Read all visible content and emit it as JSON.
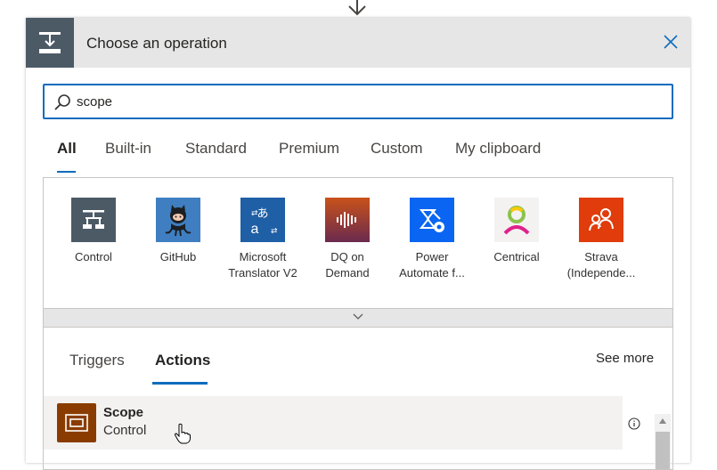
{
  "dialog": {
    "title": "Choose an operation",
    "header_icon": "operation-icon",
    "close_icon": "close-icon"
  },
  "search": {
    "value": "scope",
    "icon": "search-icon"
  },
  "tabs": [
    {
      "label": "All",
      "active": true
    },
    {
      "label": "Built-in"
    },
    {
      "label": "Standard"
    },
    {
      "label": "Premium"
    },
    {
      "label": "Custom"
    },
    {
      "label": "My clipboard"
    }
  ],
  "connectors": [
    {
      "label_line1": "Control",
      "label_line2": "",
      "icon": "control-icon",
      "color": "#4c5a66"
    },
    {
      "label_line1": "GitHub",
      "label_line2": "",
      "icon": "github-octocat-icon",
      "color": "#3f7fc1"
    },
    {
      "label_line1": "Microsoft",
      "label_line2": "Translator V2",
      "icon": "translator-icon",
      "color": "#1f5fa6"
    },
    {
      "label_line1": "DQ on",
      "label_line2": "Demand",
      "icon": "soundwave-icon",
      "color": "#c14f1c"
    },
    {
      "label_line1": "Power",
      "label_line2": "Automate f...",
      "icon": "power-automate-icon",
      "color": "#0a66f2"
    },
    {
      "label_line1": "Centrical",
      "label_line2": "",
      "icon": "centrical-icon",
      "color": "#f3f2f1"
    },
    {
      "label_line1": "Strava",
      "label_line2": "(Independe...",
      "icon": "strava-people-icon",
      "color": "#e03c0c"
    }
  ],
  "subtabs": [
    {
      "label": "Triggers"
    },
    {
      "label": "Actions",
      "active": true
    }
  ],
  "see_more": "See more",
  "actions": [
    {
      "title": "Scope",
      "subtitle": "Control",
      "icon": "scope-icon",
      "color": "#8a3c00"
    }
  ],
  "colors": {
    "accent": "#0f6cbd",
    "header_bg": "#e6e6e6"
  }
}
